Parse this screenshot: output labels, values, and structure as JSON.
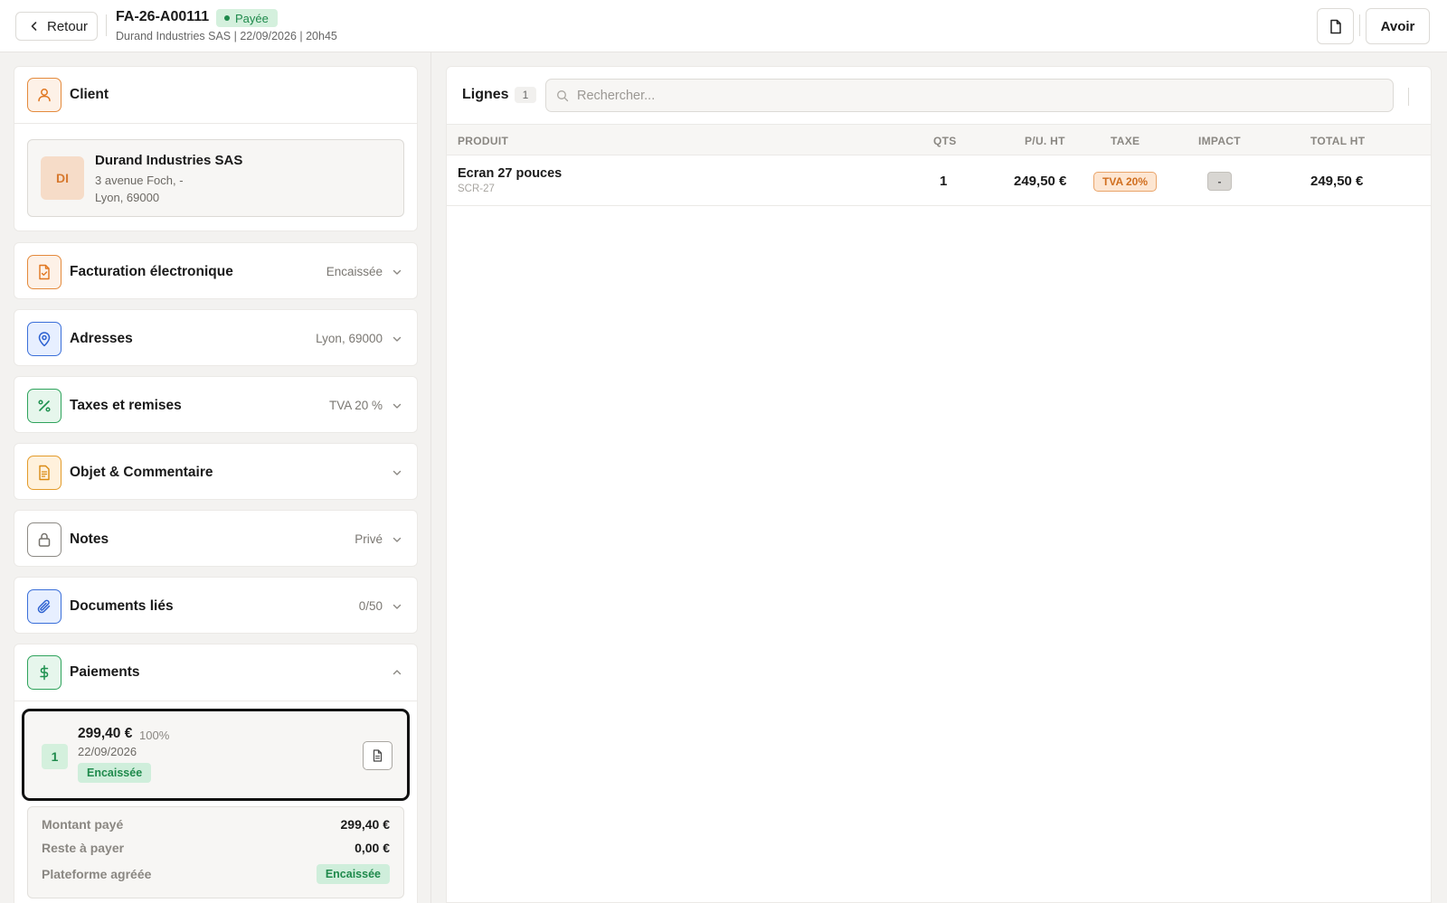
{
  "header": {
    "back_label": "Retour",
    "doc_number": "FA-26-A00111",
    "status": "Payée",
    "subtitle": "Durand Industries SAS | 22/09/2026 | 20h45",
    "avoir_label": "Avoir"
  },
  "client": {
    "section_title": "Client",
    "initials": "DI",
    "name": "Durand Industries SAS",
    "address_line1": "3 avenue Foch, -",
    "address_line2": "Lyon, 69000"
  },
  "sections": [
    {
      "title": "Facturation électronique",
      "value": "Encaissée",
      "icon": "file-check-icon"
    },
    {
      "title": "Adresses",
      "value": "Lyon, 69000",
      "icon": "map-pin-icon"
    },
    {
      "title": "Taxes et remises",
      "value": "TVA 20 %",
      "icon": "percent-icon"
    },
    {
      "title": "Objet & Commentaire",
      "value": "",
      "icon": "document-text-icon"
    },
    {
      "title": "Notes",
      "value": "Privé",
      "icon": "lock-icon"
    },
    {
      "title": "Documents liés",
      "value": "0/50",
      "icon": "paperclip-icon"
    }
  ],
  "payments": {
    "section_title": "Paiements",
    "items": [
      {
        "index": "1",
        "amount": "299,40 €",
        "percent": "100%",
        "date": "22/09/2026",
        "status": "Encaissée"
      }
    ],
    "summary": {
      "paid_label": "Montant payé",
      "paid_value": "299,40 €",
      "remaining_label": "Reste à payer",
      "remaining_value": "0,00 €",
      "platform_label": "Plateforme agréée",
      "platform_value": "Encaissée"
    }
  },
  "lines": {
    "title": "Lignes",
    "count": "1",
    "search_placeholder": "Rechercher...",
    "columns": {
      "product": "PRODUIT",
      "qty": "QTS",
      "unit_price": "P/U. HT",
      "tax": "TAXE",
      "impact": "IMPACT",
      "total": "TOTAL HT"
    },
    "rows": [
      {
        "name": "Ecran 27 pouces",
        "sku": "SCR-27",
        "qty": "1",
        "unit_price": "249,50 €",
        "tax": "TVA 20%",
        "impact": "-",
        "total": "249,50 €"
      }
    ]
  },
  "colors": {
    "accent_green": "#1f8a4c",
    "accent_orange": "#e0761f",
    "accent_blue": "#2d62d1"
  }
}
